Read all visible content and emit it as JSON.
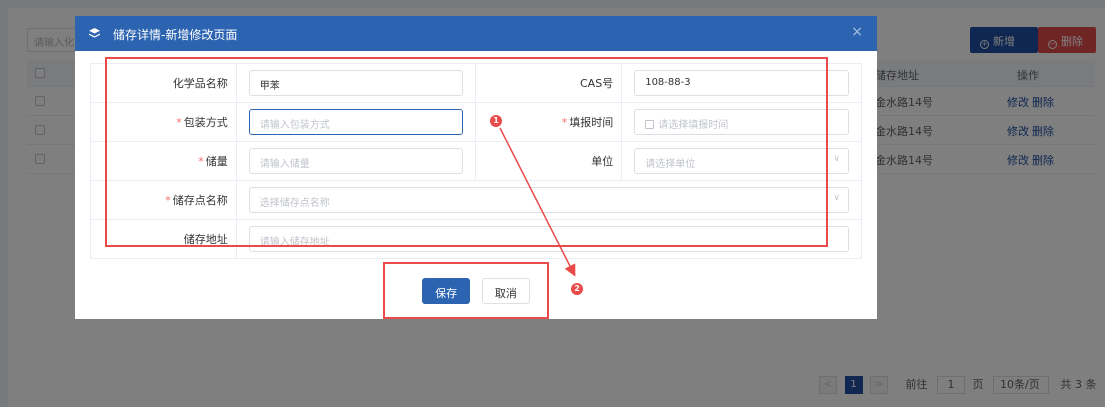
{
  "background": {
    "search_placeholder": "请输入化",
    "add_label": "新增",
    "delete_label": "删除",
    "columns": {
      "address": "储存地址",
      "actions": "操作"
    },
    "rows": [
      {
        "address": "金水路14号",
        "edit": "修改",
        "delete": "删除"
      },
      {
        "address": "金水路14号",
        "edit": "修改",
        "delete": "删除"
      },
      {
        "address": "金水路14号",
        "edit": "修改",
        "delete": "删除"
      }
    ],
    "pager": {
      "prev": "<",
      "current": "1",
      "next": ">",
      "goto_label": "前往",
      "goto_value": "1",
      "page_unit": "页",
      "page_size": "10条/页",
      "total": "共 3 条"
    }
  },
  "dialog": {
    "title": "储存详情-新增修改页面",
    "close": "×",
    "fields": {
      "chem_name": {
        "label": "化学品名称",
        "value": "甲苯"
      },
      "cas": {
        "label": "CAS号",
        "value": "108-88-3"
      },
      "package": {
        "label": "包装方式",
        "placeholder": "请输入包装方式"
      },
      "report_time": {
        "label": "填报时间",
        "placeholder": "请选择填报时间"
      },
      "amount": {
        "label": "储量",
        "placeholder": "请输入储量"
      },
      "unit": {
        "label": "单位",
        "placeholder": "请选择单位"
      },
      "storage_name": {
        "label": "储存点名称",
        "placeholder": "选择储存点名称"
      },
      "storage_addr": {
        "label": "储存地址",
        "placeholder": "请输入储存地址"
      }
    },
    "required_mark": "*",
    "save_label": "保存",
    "cancel_label": "取消"
  },
  "annotations": {
    "marker1": "1",
    "marker2": "2",
    "color": "#e94b4b"
  }
}
